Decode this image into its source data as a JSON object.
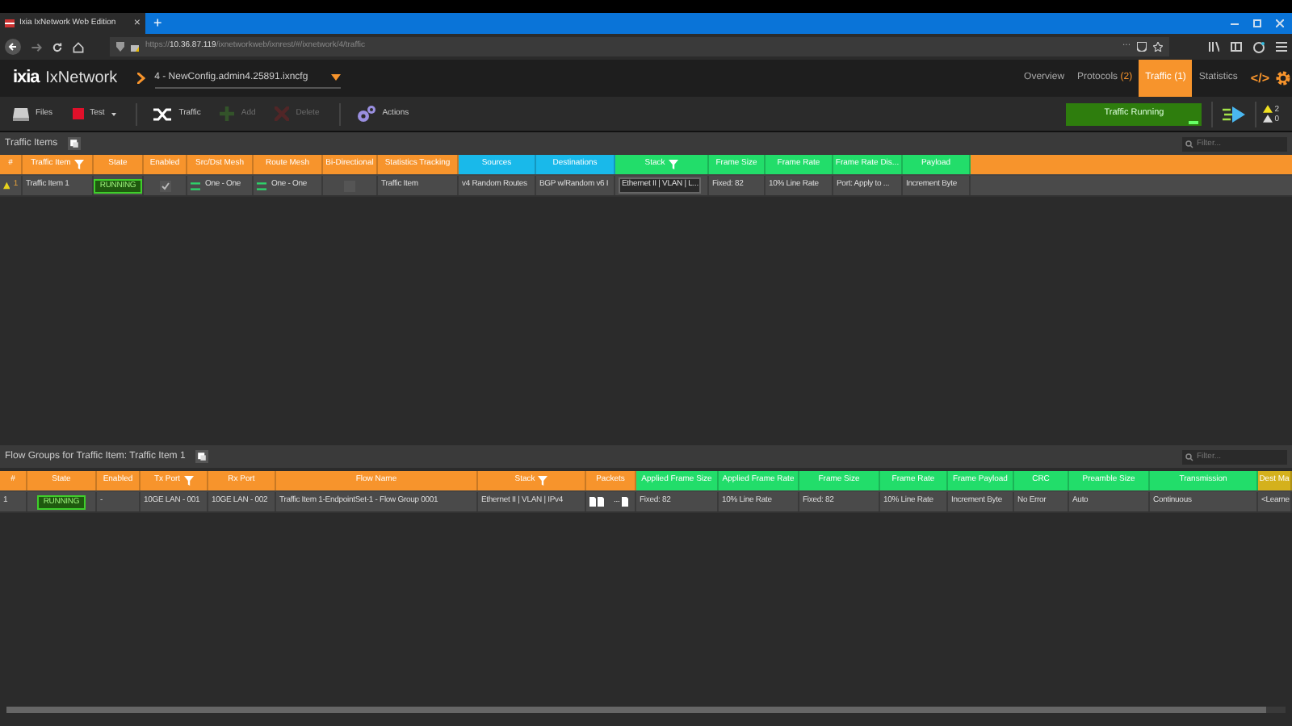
{
  "browser": {
    "tab_title": "Ixia IxNetwork Web Edition",
    "close": "×",
    "new_tab": "+",
    "url_prefix": "https://",
    "url_host": "10.36.87.119",
    "url_path": "/ixnetworkweb/ixnrest/#/ixnetwork/4/traffic",
    "more": "···"
  },
  "app": {
    "logo": "ixia",
    "product": "IxNetwork",
    "config": "4 - NewConfig.admin4.25891.ixncfg",
    "nav": [
      {
        "label": "Overview",
        "selected": false
      },
      {
        "label": "Protocols",
        "count": "(2)",
        "selected": false
      },
      {
        "label": "Traffic",
        "count": "(1)",
        "selected": true
      },
      {
        "label": "Statistics",
        "selected": false
      }
    ],
    "code_label": "</>"
  },
  "toolbar": {
    "items": [
      {
        "kind": "files",
        "label": "Files",
        "disabled": false
      },
      {
        "kind": "test",
        "label": "Test",
        "disabled": false
      },
      {
        "kind": "traffic",
        "label": "Traffic",
        "disabled": false
      },
      {
        "kind": "add",
        "label": "Add",
        "disabled": true
      },
      {
        "kind": "delete",
        "label": "Delete",
        "disabled": true
      },
      {
        "kind": "actions",
        "label": "Actions",
        "disabled": false
      }
    ],
    "status": "Traffic Running",
    "alerts": [
      {
        "kind": "warning",
        "count": "2"
      },
      {
        "kind": "info",
        "count": "0"
      }
    ]
  },
  "traffic_items": {
    "title": "Traffic Items",
    "filter_placeholder": "Filter...",
    "columns": [
      {
        "label": "#",
        "color": "#f7942c",
        "filter": false
      },
      {
        "label": "Traffic Item",
        "color": "#f7942c",
        "filter": true
      },
      {
        "label": "State",
        "color": "#f7942c",
        "filter": false
      },
      {
        "label": "Enabled",
        "color": "#f7942c",
        "filter": false
      },
      {
        "label": "Src/Dst Mesh",
        "color": "#f7942c",
        "filter": false
      },
      {
        "label": "Route Mesh",
        "color": "#f7942c",
        "filter": false
      },
      {
        "label": "Bi-Directional",
        "color": "#f7942c",
        "filter": false
      },
      {
        "label": "Statistics Tracking",
        "color": "#f7942c",
        "filter": false
      },
      {
        "label": "Sources",
        "color": "#19b9ea",
        "filter": false
      },
      {
        "label": "Destinations",
        "color": "#19b9ea",
        "filter": false
      },
      {
        "label": "Stack",
        "color": "#22dd6a",
        "filter": true
      },
      {
        "label": "Frame Size",
        "color": "#22dd6a",
        "filter": false
      },
      {
        "label": "Frame Rate",
        "color": "#22dd6a",
        "filter": false
      },
      {
        "label": "Frame Rate Dis...",
        "color": "#22dd6a",
        "filter": false
      },
      {
        "label": "Payload",
        "color": "#22dd6a",
        "filter": false
      }
    ],
    "rows": [
      [
        {
          "kind": "warn",
          "text": "1"
        },
        {
          "kind": "text",
          "text": "Traffic Item 1"
        },
        {
          "kind": "badge",
          "text": "RUNNING"
        },
        {
          "kind": "check",
          "checked": true
        },
        {
          "kind": "mesh",
          "text": "One - One"
        },
        {
          "kind": "mesh",
          "text": "One - One"
        },
        {
          "kind": "check",
          "checked": false
        },
        {
          "kind": "text",
          "text": "Traffic Item"
        },
        {
          "kind": "text",
          "text": "v4 Random Routes"
        },
        {
          "kind": "text",
          "text": "BGP w/Random v6 I"
        },
        {
          "kind": "boxed",
          "text": "Ethernet II | VLAN | L..."
        },
        {
          "kind": "text",
          "text": "Fixed: 82"
        },
        {
          "kind": "text",
          "text": "10% Line Rate"
        },
        {
          "kind": "text",
          "text": "Port: Apply to ..."
        },
        {
          "kind": "text",
          "text": "Increment Byte"
        }
      ]
    ]
  },
  "flow_groups": {
    "title": "Flow Groups for Traffic Item: Traffic Item 1",
    "filter_placeholder": "Filter...",
    "columns": [
      {
        "label": "#",
        "color": "#f7942c",
        "filter": false
      },
      {
        "label": "State",
        "color": "#f7942c",
        "filter": false
      },
      {
        "label": "Enabled",
        "color": "#f7942c",
        "filter": false
      },
      {
        "label": "Tx Port",
        "color": "#f7942c",
        "filter": true
      },
      {
        "label": "Rx Port",
        "color": "#f7942c",
        "filter": false
      },
      {
        "label": "Flow Name",
        "color": "#f7942c",
        "filter": false
      },
      {
        "label": "Stack",
        "color": "#f7942c",
        "filter": true
      },
      {
        "label": "Packets",
        "color": "#f7942c",
        "filter": false
      },
      {
        "label": "Applied Frame Size",
        "color": "#22dd6a",
        "filter": false
      },
      {
        "label": "Applied Frame Rate",
        "color": "#22dd6a",
        "filter": false
      },
      {
        "label": "Frame Size",
        "color": "#22dd6a",
        "filter": false
      },
      {
        "label": "Frame Rate",
        "color": "#22dd6a",
        "filter": false
      },
      {
        "label": "Frame Payload",
        "color": "#22dd6a",
        "filter": false
      },
      {
        "label": "CRC",
        "color": "#22dd6a",
        "filter": false
      },
      {
        "label": "Preamble Size",
        "color": "#22dd6a",
        "filter": false
      },
      {
        "label": "Transmission",
        "color": "#22dd6a",
        "filter": false
      },
      {
        "label": "Dest Ma",
        "color": "#d4b11c",
        "filter": false
      }
    ],
    "rows": [
      [
        {
          "kind": "text",
          "text": "1"
        },
        {
          "kind": "badge",
          "text": "RUNNING"
        },
        {
          "kind": "text",
          "text": "-"
        },
        {
          "kind": "text",
          "text": "10GE LAN - 001"
        },
        {
          "kind": "text",
          "text": "10GE LAN - 002"
        },
        {
          "kind": "text",
          "text": "Traffic Item 1-EndpointSet-1 - Flow Group 0001"
        },
        {
          "kind": "text",
          "text": "Ethernet II | VLAN | IPv4"
        },
        {
          "kind": "packets",
          "text": "..."
        },
        {
          "kind": "text",
          "text": "Fixed: 82"
        },
        {
          "kind": "text",
          "text": "10% Line Rate"
        },
        {
          "kind": "text",
          "text": "Fixed: 82"
        },
        {
          "kind": "text",
          "text": "10% Line Rate"
        },
        {
          "kind": "text",
          "text": "Increment Byte"
        },
        {
          "kind": "text",
          "text": "No Error"
        },
        {
          "kind": "text",
          "text": "Auto"
        },
        {
          "kind": "text",
          "text": "Continuous"
        },
        {
          "kind": "text",
          "text": "<Learne"
        }
      ]
    ]
  }
}
